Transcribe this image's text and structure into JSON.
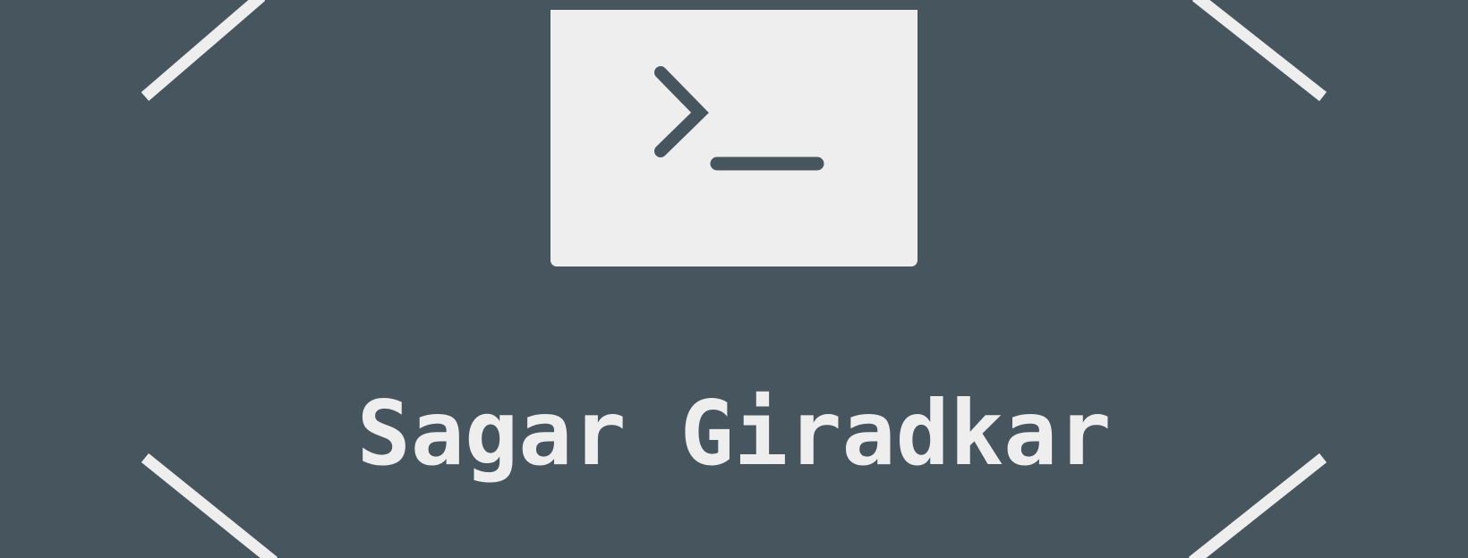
{
  "banner": {
    "name": "Sagar Giradkar",
    "background_color": "#47555f",
    "foreground_color": "#eeeeee",
    "icon": "terminal-prompt-icon"
  }
}
